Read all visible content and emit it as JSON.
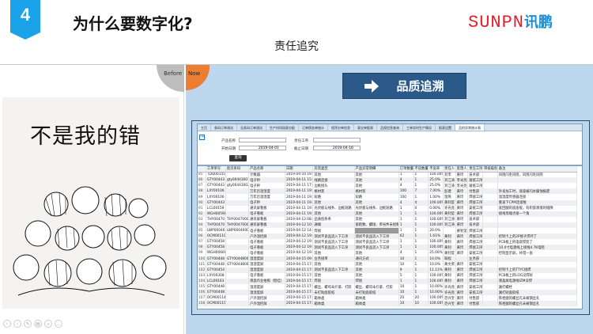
{
  "slide": {
    "number": "4",
    "title": "为什么要数字化?",
    "subtitle": "责任追究",
    "logo_text": "SUNPN",
    "logo_cn": "讯鹏"
  },
  "before": {
    "label": "Before",
    "caption": "不是我的错"
  },
  "now": {
    "label": "Now",
    "button_label": "品质追溯",
    "button_icon": "arrow-right-icon"
  },
  "colors": {
    "accent": "#1aa3e8",
    "button": "#2b5a8a",
    "panel": "#bdd7ee",
    "now": "#ed7d31",
    "before": "#bdbdbd",
    "logo": "#e0202a"
  },
  "app": {
    "tabs": [
      "主页",
      "条码订单测试",
      "无条码订单测试",
      "生产时间段表分配",
      "订单债务单统计",
      "程序分单信息",
      "表尖单报表",
      "品保信息查询",
      "工单实时生产情况",
      "报表设置",
      "品检异常统计表"
    ],
    "active_tab": 10,
    "filter": {
      "product_label": "产品名称",
      "product_value": "",
      "process_label": "责任工序",
      "process_value": "",
      "start_label": "开始日期",
      "start_value": "2019-04-01",
      "end_label": "截止日期",
      "end_value": "2019-04-16",
      "query_button": "查询"
    },
    "columns": [
      "",
      "工单单号",
      "批次条码",
      "产品名称",
      "日期",
      "异常类型",
      "产品异常明细",
      "订单数量",
      "不良数量",
      "不良率",
      "责任人",
      "反馈人",
      "责任工序",
      "审核级别",
      "备注"
    ],
    "rows": [
      [
        "85",
        "TDQ00155",
        "",
        "计数器",
        "2019-04-10 19:29:37",
        "其他",
        "其他",
        "1",
        "1",
        "100.00%",
        "刘李",
        "黄玲",
        "技术部",
        "",
        "风阻闪毛风阻，风阻闪毛风阻"
      ],
      [
        "86",
        "GTY00443",
        "gty00443001",
        "电子秤",
        "2019-04-11 15:13:07",
        "线路连接",
        "其他",
        "4",
        "1",
        "25.0%",
        "刘江涛",
        "李光亮",
        "玻纸工序",
        "",
        ""
      ],
      [
        "87",
        "GTY00443",
        "gty00443002",
        "电子秤",
        "2019-04-11 17:04:43",
        "边框接头",
        "其他",
        "4",
        "1",
        "25.0%",
        "刘江涛",
        "李光亮",
        "玻纸工序",
        "",
        ""
      ],
      [
        "88",
        "LXY00106",
        "",
        "万年历温湿度",
        "2019-04-11 19:52:15",
        "格材装",
        "格材装",
        "100",
        "7",
        "7.00%",
        "彭建",
        "黄玲",
        "付售部",
        "",
        "外发加工时，底座被闪水腐蚀报废"
      ],
      [
        "89",
        "LXY00106",
        "",
        "万年历温湿度",
        "2019-04-11 19:53:31",
        "短路",
        "短路",
        "100",
        "1",
        "1.00%",
        "温燕",
        "黄玲",
        "焊接工序",
        "",
        "温湿度传感器连接"
      ],
      [
        "90",
        "GTY00443",
        "",
        "电子秤",
        "2019-04-11 19:54:38",
        "其他",
        "其他",
        "4",
        "4",
        "100.00%",
        "黄钊莹",
        "黄玲",
        "焊接工序",
        "",
        "重发下CPM连接框"
      ],
      [
        "91",
        "LCL00159",
        "",
        "通讯屏看板",
        "2019-04-11 19:56:17",
        "光伏板与线条、边框短路",
        "光伏板与线条、边框短路",
        "1",
        "0",
        "0.00%",
        "许光亮",
        "黄玲",
        "安纸工序",
        "",
        "底回腿的底座板，有积胶滑落的缝隙"
      ],
      [
        "92",
        "WGH00598",
        "",
        "电子看板",
        "2019-04-11 19:57:39",
        "其他",
        "其他",
        "1",
        "1",
        "100.00%",
        "黄钊莹",
        "黄玲",
        "焊接工序",
        "",
        "接线母端点接一个角"
      ],
      [
        "93",
        "THY00470",
        "THY00470001",
        "通讯屏看板",
        "2019-04-12 08:49:35",
        "品质低条条",
        "其他",
        "1",
        "1",
        "100.00%",
        "刘江涛",
        "黄玲",
        "技术部",
        "",
        ""
      ],
      [
        "94",
        "THY00470",
        "THY00470001",
        "通讯屏看板",
        "2019-04-12 10:11:44",
        "通端",
        "嵌距数、螺接、单光件未组粉红",
        "1",
        "1",
        "100.00%",
        "刘江涛",
        "黄玲",
        "技术部",
        "",
        ""
      ],
      [
        "95",
        "LWP00046",
        "LWP00046001",
        "电子看板",
        "2019-04-12 14:49:23",
        "焊接",
        "",
        "1",
        "1",
        "20.0%",
        "",
        "黄钊莹",
        "焊接工序",
        "",
        ""
      ],
      [
        "96",
        "OCM00110",
        "",
        "户外温控屏",
        "2019-04-12 19:43:04",
        "测试不良品流入下工序",
        "测试不良品流入下工序",
        "62",
        "1",
        "1.61%",
        "黄钊",
        "黄玲",
        "焊接工序",
        "",
        "控制卡上的2P接子焊坏了"
      ],
      [
        "97",
        "GTY00458",
        "",
        "电子看板",
        "2019-04-12 19:44:02",
        "测试不良品流入下工序",
        "测试不良品流入下工序",
        "1",
        "1",
        "100.00%",
        "黄钊",
        "黄玲",
        "焊接工序",
        "",
        "PCB板上的电容焊反了"
      ],
      [
        "98",
        "GTY00458",
        "",
        "电子看板",
        "2019-04-12 19:45:03",
        "测试不良品流入下工序",
        "测试不良品流入下工序",
        "1",
        "1",
        "100.00%",
        "黄钊",
        "黄玲",
        "焊接工序",
        "",
        "10.0寸电源线上接线4.7K电阻"
      ],
      [
        "99",
        "WGH00600",
        "",
        "电子看板",
        "2019-04-12 19:46:11",
        "其他",
        "其他",
        "4",
        "1",
        "25.00%",
        "黄钊莹",
        "黄玲",
        "安纸工序",
        "",
        "控制显示屏，补错一张"
      ],
      [
        "100",
        "GTY00448",
        "GTY00448009",
        "温湿度屏",
        "2019-04-15 09:30:11",
        "业务接单",
        "通讯方式",
        "10",
        "1",
        "10.0%",
        "缺程",
        "",
        "业务部",
        "",
        ""
      ],
      [
        "101",
        "GTY00448",
        "GTY00448005",
        "温湿度屏",
        "2019-04-15 17:25:32",
        "其他",
        "其他",
        "10",
        "1",
        "10.0%",
        "黄文英",
        "黄玲",
        "安纸工序",
        "",
        ""
      ],
      [
        "102",
        "GTY00454",
        "",
        "温湿度屏",
        "2019-04-15 17:36:35",
        "测试不良品流入下工序",
        "其他",
        "9",
        "1",
        "11.11%",
        "黄钊",
        "黄玲",
        "焊接工序",
        "",
        "控制卡上的TTYC接焊"
      ],
      [
        "103",
        "LXY00308",
        "",
        "电子看板",
        "2019-04-15 17:37:51",
        "其他",
        "其他",
        "5",
        "1",
        "100.00%",
        "黄钊",
        "黄玲",
        "焊接工序",
        "",
        "PCB板上的LOG没焊好"
      ],
      [
        "104",
        "LCL00163",
        "",
        "液晶作业拍照（壁挂）",
        "2019-04-15 17:39:07",
        "焊接",
        "焊接",
        "1",
        "1",
        "100.00%",
        "黄钊",
        "黄玲",
        "焊接工序",
        "",
        "液晶屏电源线IZM没焊"
      ],
      [
        "105",
        "GTY00448",
        "",
        "温湿度屏",
        "2019-04-15 17:40:36",
        "螺丝、螺母未拧紧、打胶",
        "螺丝、螺母未拧紧、打胶",
        "10",
        "1",
        "10.00%",
        "许光亮",
        "黄玲",
        "安纸工序",
        "",
        "漏打螺栓"
      ],
      [
        "106",
        "GTY00448",
        "",
        "温湿度屏",
        "2019-04-15 17:41:36",
        "未打贴面胶纸",
        "未打贴面胶纸",
        "10",
        "1",
        "10.00%",
        "许光亮",
        "黄玲",
        "安纸工序",
        "",
        "漏打贴面胶纸"
      ],
      [
        "107",
        "OCM00114",
        "",
        "户外温控屏",
        "2019-04-15 17:43:01",
        "箱体类",
        "箱体类",
        "20",
        "20",
        "100.00%",
        "范兴宝",
        "黄玲",
        "付售部",
        "",
        "铁柜腿的螺丝孔未被钢丝孔"
      ],
      [
        "108",
        "OCM00115",
        "",
        "户外温控屏",
        "2019-04-15 17:43:50",
        "箱体类",
        "箱体类",
        "10",
        "10",
        "100.00%",
        "范兴宝",
        "黄玲",
        "付售部",
        "",
        "铁柜腿的螺丝孔未被钢丝孔"
      ]
    ]
  }
}
